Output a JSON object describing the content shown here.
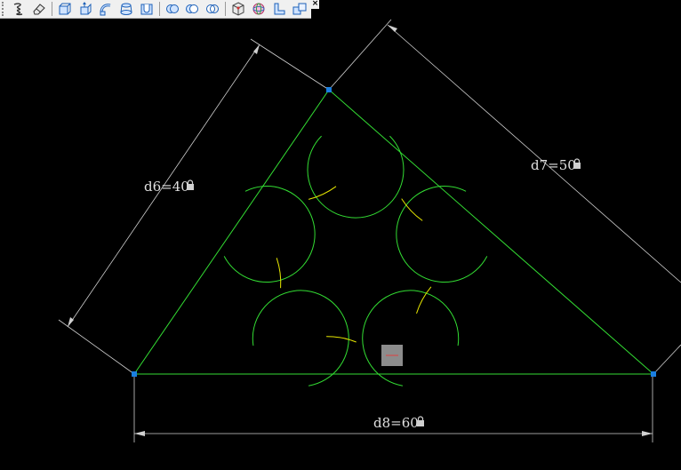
{
  "toolbar": {
    "buttons": [
      {
        "icon": "spring-icon"
      },
      {
        "icon": "eraser-icon"
      },
      {
        "icon": "extrude-icon"
      },
      {
        "icon": "revolve-icon"
      },
      {
        "icon": "sweep-icon"
      },
      {
        "icon": "loft-icon"
      },
      {
        "icon": "shell-icon"
      },
      {
        "icon": "union-icon"
      },
      {
        "icon": "subtract-icon"
      },
      {
        "icon": "intersect-icon"
      },
      {
        "icon": "cube-view-icon"
      },
      {
        "icon": "sphere-view-icon"
      },
      {
        "icon": "section-icon"
      },
      {
        "icon": "assembly-icon"
      }
    ],
    "close_label": "×"
  },
  "dimensions": {
    "d6": "d6=40",
    "d7": "d7=50",
    "d8": "d8=60"
  },
  "colors": {
    "background": "#000000",
    "triangle": "#33dd33",
    "petals": "#33dd33",
    "inner_arcs": "#e8e800",
    "dimension_lines": "#d0d0d0",
    "grip_points": "#1a7fe0",
    "center_marker": "#8c8c8c",
    "center_marker_line": "#e04040"
  }
}
